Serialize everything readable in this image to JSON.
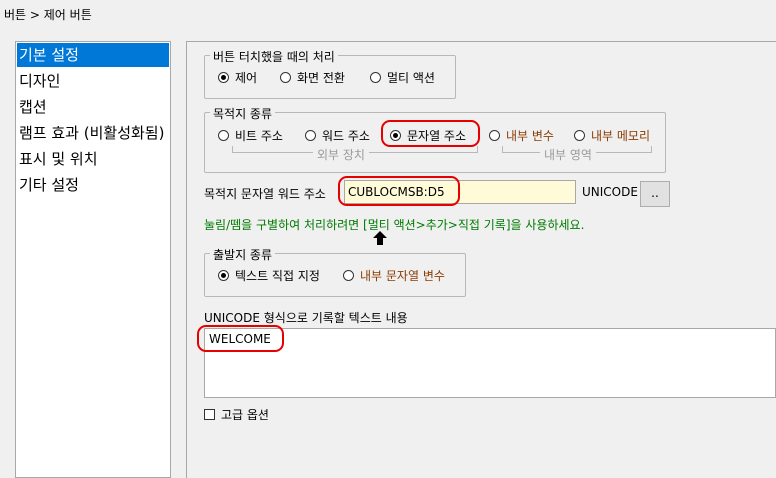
{
  "breadcrumb": "버튼 > 제어 버튼",
  "sidebar": {
    "items": [
      {
        "label": "기본 설정",
        "selected": true
      },
      {
        "label": "디자인"
      },
      {
        "label": "캡션"
      },
      {
        "label": "램프 효과 (비활성화됨)"
      },
      {
        "label": "표시 및 위치"
      },
      {
        "label": "기타 설정"
      }
    ]
  },
  "touch_action": {
    "legend": "버튼 터치했을 때의 처리",
    "options": [
      {
        "label": "제어",
        "checked": true
      },
      {
        "label": "화면 전환"
      },
      {
        "label": "멀티 액션"
      }
    ]
  },
  "destination_type": {
    "legend": "목적지 종류",
    "options": [
      {
        "label": "비트 주소"
      },
      {
        "label": "워드 주소"
      },
      {
        "label": "문자열 주소",
        "checked": true
      },
      {
        "label": "내부 변수"
      },
      {
        "label": "내부 메모리"
      }
    ],
    "external_label": "외부 장치",
    "internal_label": "내부 영역"
  },
  "destination_address": {
    "label": "목적지 문자열 워드 주소",
    "value": "CUBLOCMSB:D5",
    "encoding": "UNICODE",
    "browse_label": ".."
  },
  "hint": "눌림/뗌을 구별하여 처리하려면 [멀티 액션>추가>직접 기록]을 사용하세요.",
  "arrow_icon": "up-arrow-icon",
  "source_type": {
    "legend": "출발지 종류",
    "options": [
      {
        "label": "텍스트 직접 지정",
        "checked": true
      },
      {
        "label": "내부 문자열 변수"
      }
    ]
  },
  "text_content": {
    "label": "UNICODE 형식으로 기록할 텍스트 내용",
    "value": "WELCOME"
  },
  "advanced": {
    "label": "고급 옵션",
    "checked": false
  },
  "colors": {
    "selection": "#0078d7",
    "internal_text": "#8a3b00",
    "hint_text": "#007a00",
    "highlight_ring": "#e60000",
    "input_bg": "#fffbd8"
  }
}
